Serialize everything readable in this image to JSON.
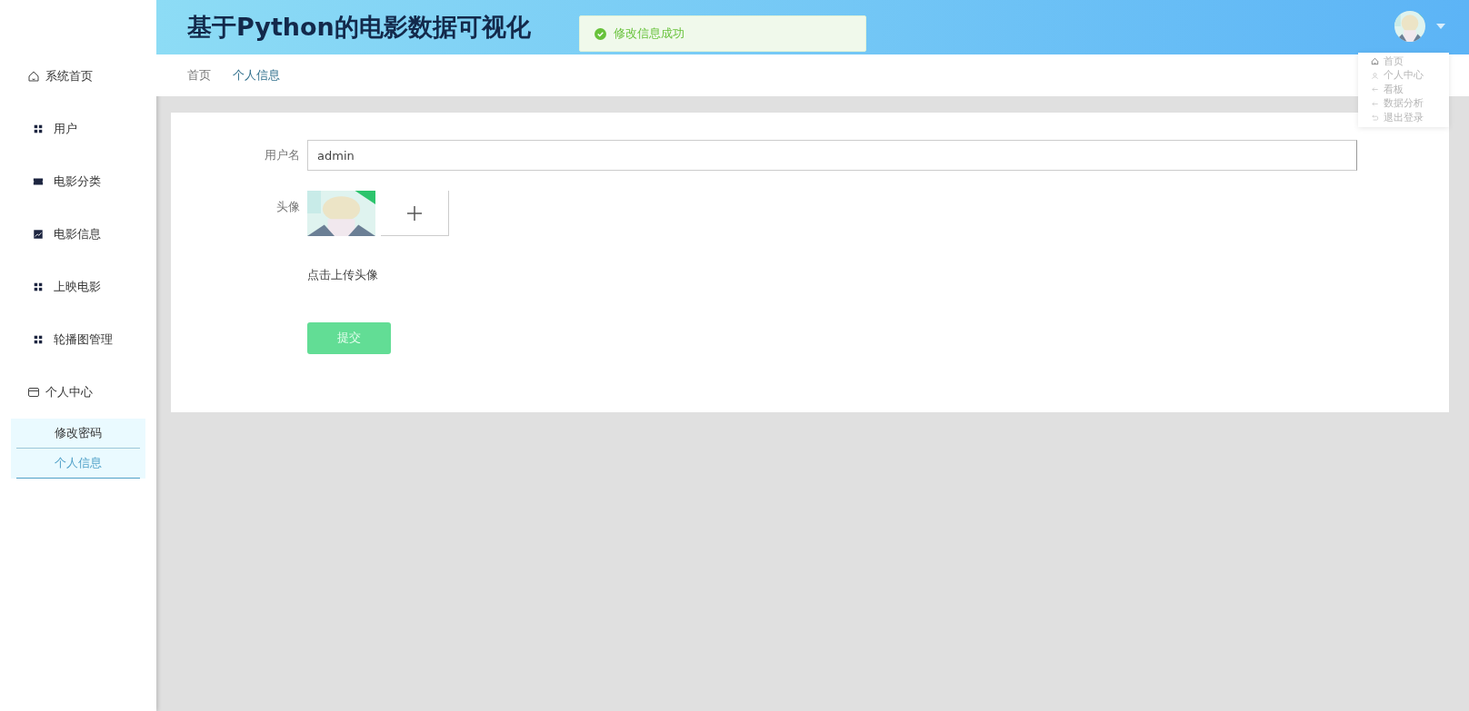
{
  "sidebar": {
    "items": [
      {
        "label": "系统首页",
        "selected": false
      },
      {
        "label": "用户",
        "selected": false
      },
      {
        "label": "电影分类",
        "selected": false
      },
      {
        "label": "电影信息",
        "selected": false
      },
      {
        "label": "上映电影",
        "selected": false
      },
      {
        "label": "轮播图管理",
        "selected": false
      },
      {
        "label": "个人中心",
        "selected": false,
        "expanded": true,
        "children": [
          {
            "label": "修改密码",
            "selected": false
          },
          {
            "label": "个人信息",
            "selected": true
          }
        ]
      }
    ]
  },
  "header": {
    "title": "基于Python的电影数据可视化",
    "user_menu": {
      "expanded": true,
      "items": [
        {
          "label": "首页"
        },
        {
          "label": "个人中心"
        },
        {
          "label": "看板"
        },
        {
          "label": "数据分析"
        },
        {
          "label": "退出登录"
        }
      ]
    }
  },
  "toast": {
    "kind": "success",
    "message": "修改信息成功"
  },
  "breadcrumb": [
    {
      "label": "首页",
      "selected": false
    },
    {
      "label": "个人信息",
      "selected": true
    }
  ],
  "form": {
    "username": {
      "label": "用户名",
      "value": "admin"
    },
    "avatar": {
      "label": "头像",
      "hint": "点击上传头像"
    },
    "submit": "提交"
  }
}
